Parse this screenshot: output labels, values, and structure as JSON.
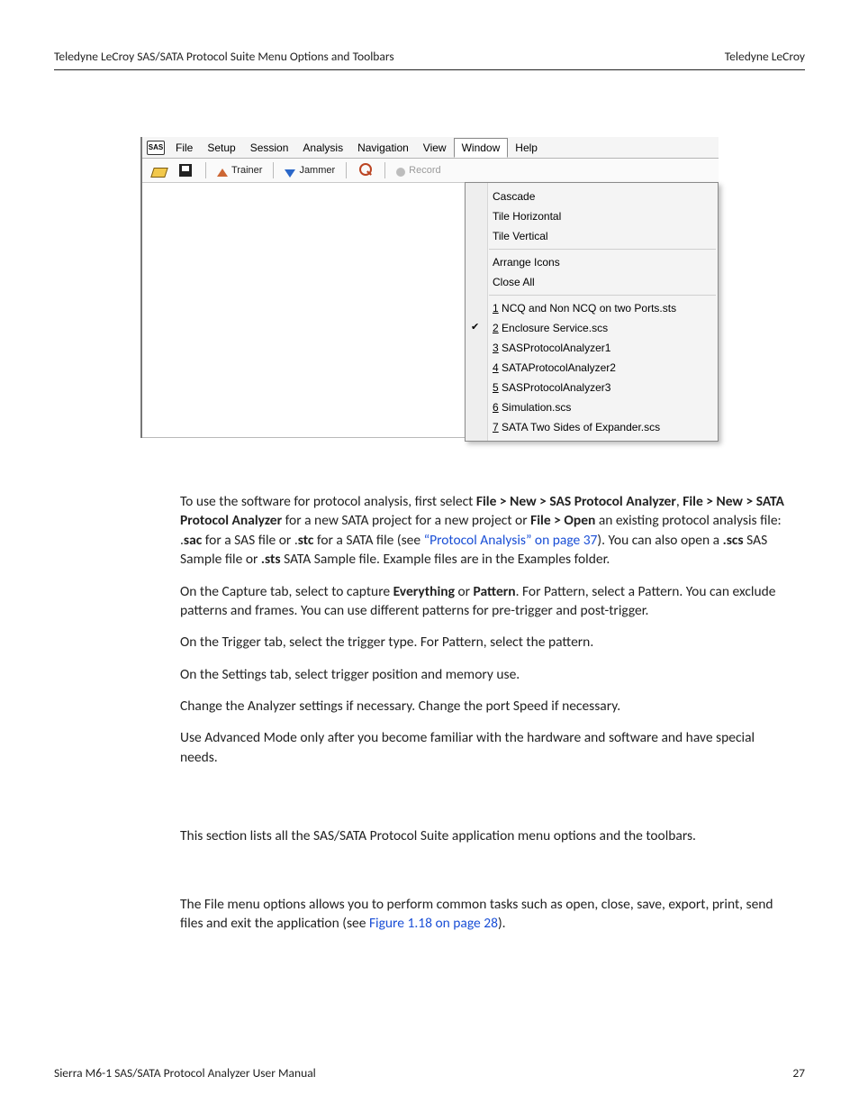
{
  "header": {
    "left": "Teledyne LeCroy SAS/SATA Protocol Suite Menu Options and Toolbars",
    "right": "Teledyne LeCroy"
  },
  "footer": {
    "left": "Sierra M6-1 SAS/SATA Protocol Analyzer User Manual",
    "right": "27"
  },
  "app": {
    "icon_label": "SAS",
    "menubar": [
      "File",
      "Setup",
      "Session",
      "Analysis",
      "Navigation",
      "View",
      "Window",
      "Help"
    ],
    "menubar_open_index": 6,
    "toolbar": {
      "open_icon": "open-icon",
      "save_icon": "save-icon",
      "trainer_icon": "trainer-up-icon",
      "trainer_label": "Trainer",
      "jammer_icon": "jammer-down-icon",
      "jammer_label": "Jammer",
      "search_icon": "search-icon",
      "record_icon": "record-dot-icon",
      "record_label": "Record"
    },
    "window_menu": {
      "group1": [
        "Cascade",
        "Tile Horizontal",
        "Tile Vertical"
      ],
      "group2": [
        "Arrange Icons",
        "Close All"
      ],
      "docs": [
        {
          "num": "1",
          "label": "NCQ and Non NCQ on two Ports.sts",
          "checked": false
        },
        {
          "num": "2",
          "label": "Enclosure Service.scs",
          "checked": true
        },
        {
          "num": "3",
          "label": "SASProtocolAnalyzer1",
          "checked": false
        },
        {
          "num": "4",
          "label": "SATAProtocolAnalyzer2",
          "checked": false
        },
        {
          "num": "5",
          "label": "SASProtocolAnalyzer3",
          "checked": false
        },
        {
          "num": "6",
          "label": "Simulation.scs",
          "checked": false
        },
        {
          "num": "7",
          "label": "SATA Two Sides of Expander.scs",
          "checked": false
        }
      ]
    }
  },
  "paras": {
    "p1a": "To use the software for protocol analysis, first select ",
    "p1b": "File > New > SAS Protocol Analyzer",
    "p1c": ", ",
    "p1d": "File > New > SATA Protocol Analyzer",
    "p1e": " for a new SATA project for a new project or ",
    "p1f": "File > Open",
    "p1g": " an existing protocol analysis file: .",
    "p1h": "sac",
    "p1i": " for a SAS file or .",
    "p1j": "stc",
    "p1k": " for a SATA file (see ",
    "p1link": "“Protocol Analysis” on page 37",
    "p1l": "). You can also open a ",
    "p1m": ".scs",
    "p1n": " SAS Sample file or ",
    "p1o": ".sts",
    "p1p": " SATA Sample file. Example files are in the Examples folder.",
    "p2a": "On the Capture tab, select to capture ",
    "p2b": "Everything",
    "p2c": " or ",
    "p2d": "Pattern",
    "p2e": ". For Pattern, select a Pattern. You can exclude patterns and frames. You can use different patterns for pre-trigger and post-trigger.",
    "p3": "On the Trigger tab, select the trigger type. For Pattern, select the pattern.",
    "p4": "On the Settings tab, select trigger position and memory use.",
    "p5": "Change the Analyzer settings if necessary. Change the port Speed if necessary.",
    "p6": "Use Advanced Mode only after you become familiar with the hardware and software and have special needs.",
    "p7": "This section lists all the SAS/SATA Protocol Suite application menu options and the toolbars.",
    "p8a": "The File menu options allows you to perform common tasks such as open, close, save, export, print, send files and exit the application (see ",
    "p8link": "Figure 1.18 on page 28",
    "p8b": ")."
  }
}
